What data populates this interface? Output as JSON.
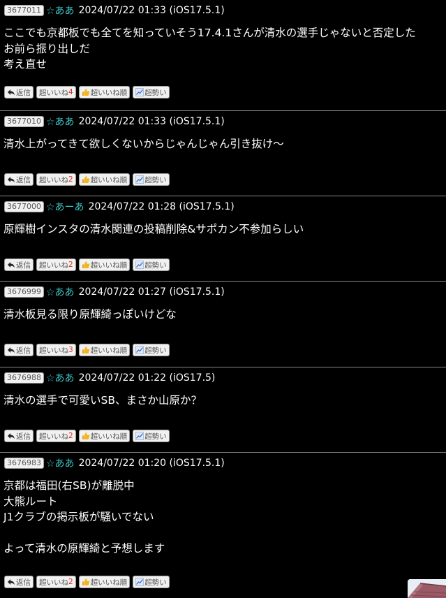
{
  "posts": [
    {
      "number": "3677011",
      "name": "☆ああ",
      "date": "2024/07/22 01:33 (iOS17.5.1)",
      "body_lines": [
        "ここでも京都板でも全てを知っていそう17.4.1さんが清水の選手じゃないと否定した",
        "お前ら振り出しだ",
        "考え直せ"
      ],
      "likes": "4"
    },
    {
      "number": "3677010",
      "name": "☆ああ",
      "date": "2024/07/22 01:33 (iOS17.5.1)",
      "body_lines": [
        "清水上がってきて欲しくないからじゃんじゃん引き抜け〜"
      ],
      "likes": "2"
    },
    {
      "number": "3677000",
      "name": "☆あーあ",
      "date": "2024/07/22 01:28 (iOS17.5.1)",
      "body_lines": [
        "原輝樹インスタの清水関連の投稿削除&サポカン不参加らしい"
      ],
      "likes": "2"
    },
    {
      "number": "3676999",
      "name": "☆ああ",
      "date": "2024/07/22 01:27 (iOS17.5.1)",
      "body_lines": [
        "清水板見る限り原輝綺っぽいけどな"
      ],
      "likes": "3"
    },
    {
      "number": "3676988",
      "name": "☆ああ",
      "date": "2024/07/22 01:22 (iOS17.5)",
      "body_lines": [
        "清水の選手で可愛いSB、まさか山原か？"
      ],
      "likes": "2"
    },
    {
      "number": "3676983",
      "name": "☆ああ",
      "date": "2024/07/22 01:20 (iOS17.5.1)",
      "body_lines": [
        "京都は福田(右SB)が離脱中",
        "大熊ルート",
        "J1クラブの掲示板が騒いでない",
        "",
        "よって清水の原輝綺と予想します"
      ],
      "likes": "2"
    }
  ],
  "actions": {
    "reply_label": "返信",
    "like_label": "超いいね",
    "like_order_label": "超いいね順",
    "momentum_label": "超勢い"
  },
  "icons": {
    "reply": "reply-arrow-icon",
    "like_order": "thumbs-up-icon",
    "momentum": "trend-chart-icon"
  },
  "colors": {
    "background": "#000000",
    "text": "#ffffff",
    "name": "#3ec6c6",
    "like_count": "#e0301e",
    "divider": "#8a8a8a",
    "button_bg": "#f1f1f1"
  }
}
